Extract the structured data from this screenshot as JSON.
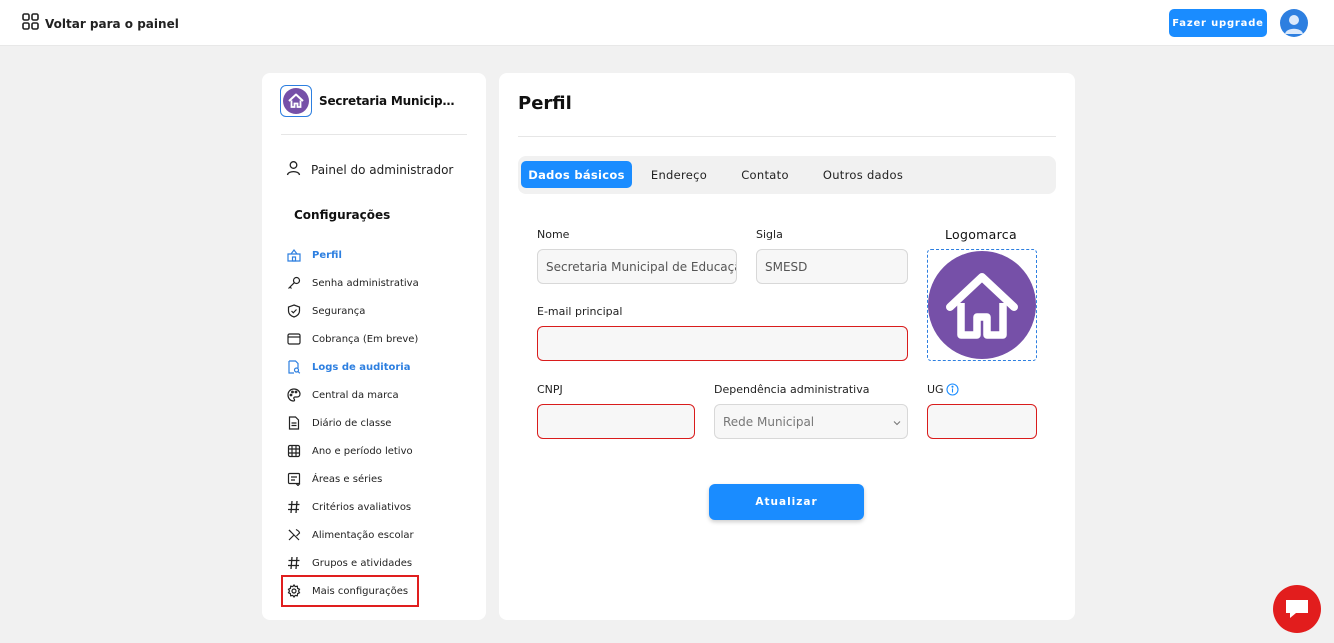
{
  "topbar": {
    "back_label": "Voltar para o painel",
    "upgrade_label": "Fazer upgrade"
  },
  "sidebar": {
    "org_name": "Secretaria Municipal de Educação",
    "admin_label": "Painel do administrador",
    "section_title": "Configurações",
    "items": [
      {
        "label": "Perfil",
        "icon": "school-icon",
        "active": true
      },
      {
        "label": "Senha administrativa",
        "icon": "key-icon"
      },
      {
        "label": "Segurança",
        "icon": "shield-icon"
      },
      {
        "label": "Cobrança (Em breve)",
        "icon": "billing-window-icon"
      },
      {
        "label": "Logs de auditoria",
        "icon": "audit-doc-icon",
        "active": true
      },
      {
        "label": "Central da marca",
        "icon": "palette-icon"
      },
      {
        "label": "Diário de classe",
        "icon": "document-icon"
      },
      {
        "label": "Ano e período letivo",
        "icon": "calendar-icon"
      },
      {
        "label": "Áreas e séries",
        "icon": "list-doc-icon"
      },
      {
        "label": "Critérios avaliativos",
        "icon": "hash-icon"
      },
      {
        "label": "Alimentação escolar",
        "icon": "utensils-icon"
      },
      {
        "label": "Grupos e atividades",
        "icon": "hash-icon"
      },
      {
        "label": "Mais configurações",
        "icon": "gear-icon",
        "highlighted": true
      }
    ]
  },
  "main": {
    "title": "Perfil",
    "tabs": [
      {
        "label": "Dados básicos",
        "active": true
      },
      {
        "label": "Endereço"
      },
      {
        "label": "Contato"
      },
      {
        "label": "Outros dados"
      }
    ],
    "form": {
      "nome_label": "Nome",
      "nome_value": "Secretaria Municipal de Educação",
      "sigla_label": "Sigla",
      "sigla_value": "SMESD",
      "logo_label": "Logomarca",
      "email_label": "E-mail principal",
      "email_value": "",
      "cnpj_label": "CNPJ",
      "cnpj_value": "",
      "dependencia_label": "Dependência administrativa",
      "dependencia_value": "Rede Municipal",
      "ug_label": "UG",
      "ug_value": "",
      "submit_label": "Atualizar"
    }
  },
  "colors": {
    "accent": "#1a8cff",
    "error": "#d91c1c",
    "logo_purple": "#7650a8",
    "chat_red": "#e21d1d"
  }
}
